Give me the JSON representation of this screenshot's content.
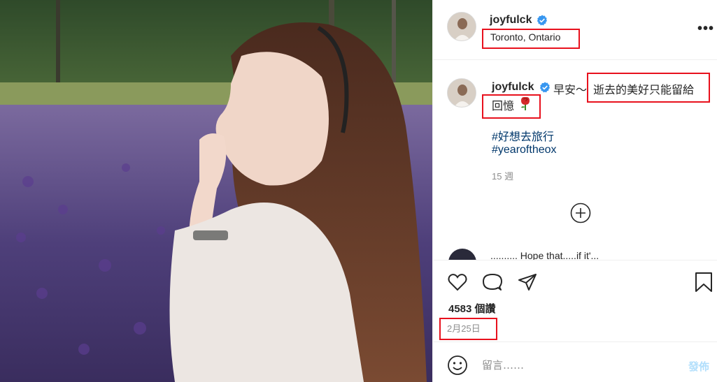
{
  "header": {
    "username": "joyfulck",
    "location": "Toronto, Ontario",
    "more_label": "•••"
  },
  "caption": {
    "username": "joyfulck",
    "text_part1": "早安～",
    "text_part2": "逝去的美好只能留給",
    "text_line2": "回憶",
    "hashtags": [
      "#好想去旅行",
      "#yearoftheox"
    ],
    "time_ago": "15 週"
  },
  "partial_comment": {
    "text": "..........  Hope that.....if it'..."
  },
  "actions": {
    "likes": "4583 個讚",
    "date": "2月25日"
  },
  "comment_bar": {
    "placeholder": "留言……",
    "post_label": "發佈"
  },
  "icons": {
    "verified": "verified-badge-icon",
    "like": "heart-icon",
    "comment": "comment-bubble-icon",
    "share": "paper-plane-icon",
    "save": "bookmark-icon",
    "emoji": "smiley-icon",
    "load_more": "plus-circle-icon"
  },
  "colors": {
    "highlight_box": "#e8111d",
    "verified_blue": "#3897f0",
    "hashtag_blue": "#00376b",
    "post_button_disabled": "#b2dffc",
    "muted_text": "#8e8e8e"
  }
}
